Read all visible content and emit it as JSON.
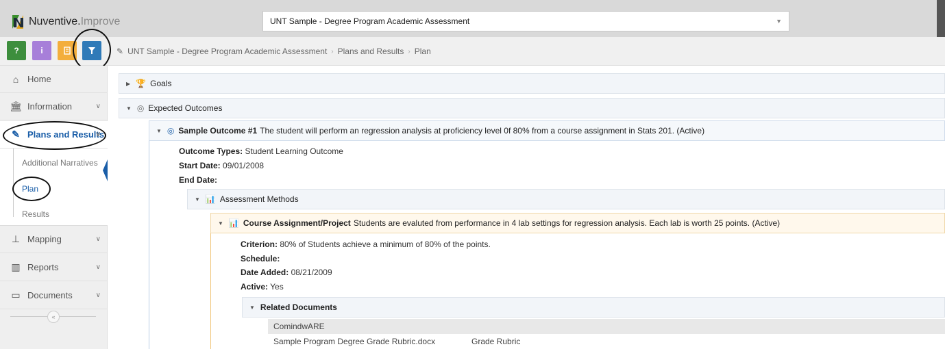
{
  "header": {
    "logo_brand": "Nuventive.",
    "logo_product": "Improve",
    "project_selected": "UNT Sample - Degree Program Academic Assessment"
  },
  "toolbar": {
    "help_label": "?",
    "info_label": "i"
  },
  "breadcrumb": {
    "items": [
      "UNT Sample - Degree Program Academic Assessment",
      "Plans and Results",
      "Plan"
    ]
  },
  "sidebar": {
    "home": "Home",
    "information": "Information",
    "plans_and_results": "Plans and Results",
    "sub_items": [
      "Additional Narratives",
      "Plan",
      "Results"
    ],
    "mapping": "Mapping",
    "reports": "Reports",
    "documents": "Documents"
  },
  "content": {
    "goals_label": "Goals",
    "expected_outcomes_label": "Expected Outcomes",
    "outcome": {
      "title": "Sample Outcome #1",
      "description": "The student will perform an regression analysis at proficiency level 0f 80% from a course assignment in Stats 201. (Active)",
      "outcome_types_label": "Outcome Types:",
      "outcome_types_value": "Student Learning Outcome",
      "start_date_label": "Start Date:",
      "start_date_value": "09/01/2008",
      "end_date_label": "End Date:"
    },
    "assessment_methods_label": "Assessment Methods",
    "method": {
      "title": "Course Assignment/Project",
      "description": "Students are evaluted from performance in 4 lab settings for regression analysis. Each lab is worth 25 points. (Active)",
      "criterion_label": "Criterion:",
      "criterion_value": "80% of Students achieve a minimum of 80% of the points.",
      "schedule_label": "Schedule:",
      "date_added_label": "Date Added:",
      "date_added_value": "08/21/2009",
      "active_label": "Active:",
      "active_value": "Yes"
    },
    "related_documents_label": "Related Documents",
    "docs_group": "ComindwARE",
    "doc": {
      "name": "Sample Program Degree Grade Rubric.docx",
      "type": "Grade Rubric"
    }
  },
  "colors": {
    "accent_blue": "#1a5ea8",
    "help_green": "#3d8e3d",
    "info_purple": "#a77fd9",
    "doc_orange": "#f3ae3d",
    "filter_blue": "#2f7ab8"
  }
}
